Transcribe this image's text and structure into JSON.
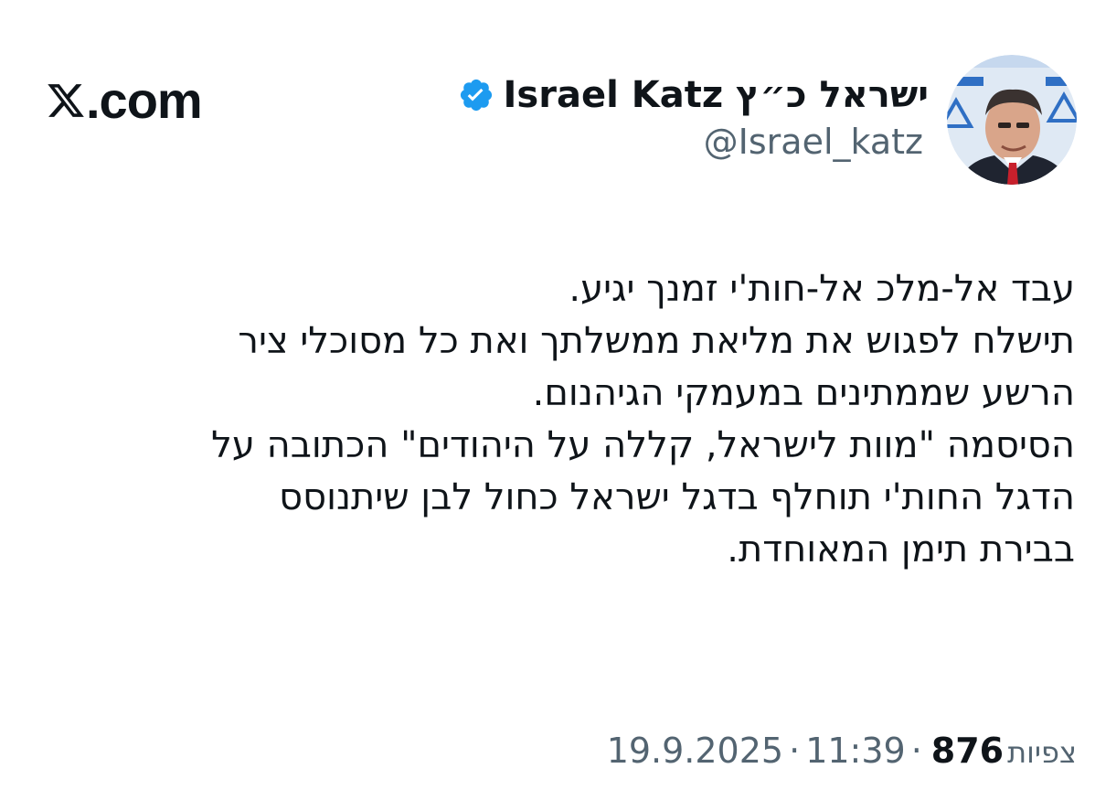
{
  "brand": {
    "domain": ".com",
    "logo_icon": "x-logo-icon"
  },
  "author": {
    "display_name": "ישראל כ״ץ Israel Katz",
    "handle": "@Israel_katz",
    "verified": true,
    "verified_color": "#1d9bf0",
    "avatar_icon": "profile-photo"
  },
  "tweet": {
    "lines": [
      "עבד אל-מלכ אל-חות'י זמנך יגיע.",
      "תישלח לפגוש את מליאת ממשלתך ואת כל מסוכלי ציר",
      "הרשע שממתינים במעמקי הגיהנום.",
      "הסיסמה \"מוות לישראל, קללה על היהודים\" הכתובה על",
      "הדגל החות'י תוחלף בדגל ישראל כחול לבן שיתנוסס",
      "בבירת תימן המאוחדת."
    ]
  },
  "meta": {
    "date": "19.9.2025",
    "separator": "·",
    "time": "11:39",
    "views_count": "876",
    "views_label": "צפיות"
  },
  "colors": {
    "text": "#0f1419",
    "secondary": "#536471",
    "verified": "#1d9bf0"
  }
}
